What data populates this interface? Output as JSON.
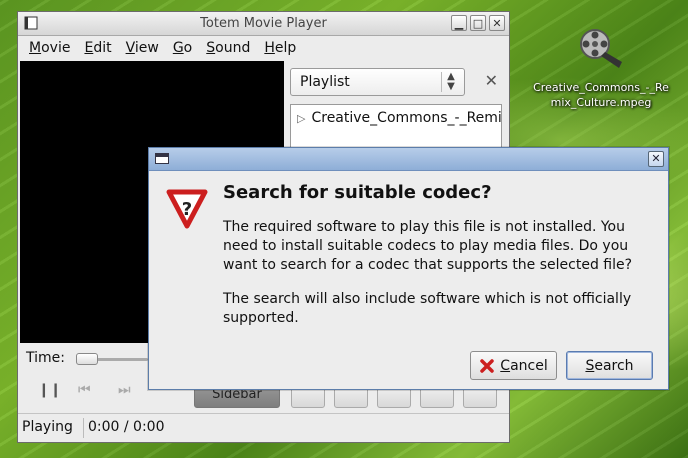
{
  "desktop": {
    "icon_label": "Creative_Commons_-_Remix_Culture.mpeg",
    "icon": "film-reel-icon"
  },
  "totem": {
    "title": "Totem Movie Player",
    "menu": [
      "Movie",
      "Edit",
      "View",
      "Go",
      "Sound",
      "Help"
    ],
    "sidebar": {
      "selector": "Playlist",
      "items": [
        "Creative_Commons_-_Remix_Culture.mpeg"
      ]
    },
    "time_label": "Time:",
    "sidebar_button": "Sidebar",
    "status": {
      "state": "Playing",
      "time": "0:00 / 0:00"
    }
  },
  "dialog": {
    "heading": "Search for suitable codec?",
    "text1": "The required software to play this file is not installed. You need to install suitable codecs to play media files. Do you want to search for a codec that supports the selected file?",
    "text2": "The search will also include software which is not officially supported.",
    "cancel_label": "Cancel",
    "search_label": "Search"
  },
  "colors": {
    "dialog_title": "#8eaed7",
    "warning_red": "#cc1f1f"
  }
}
